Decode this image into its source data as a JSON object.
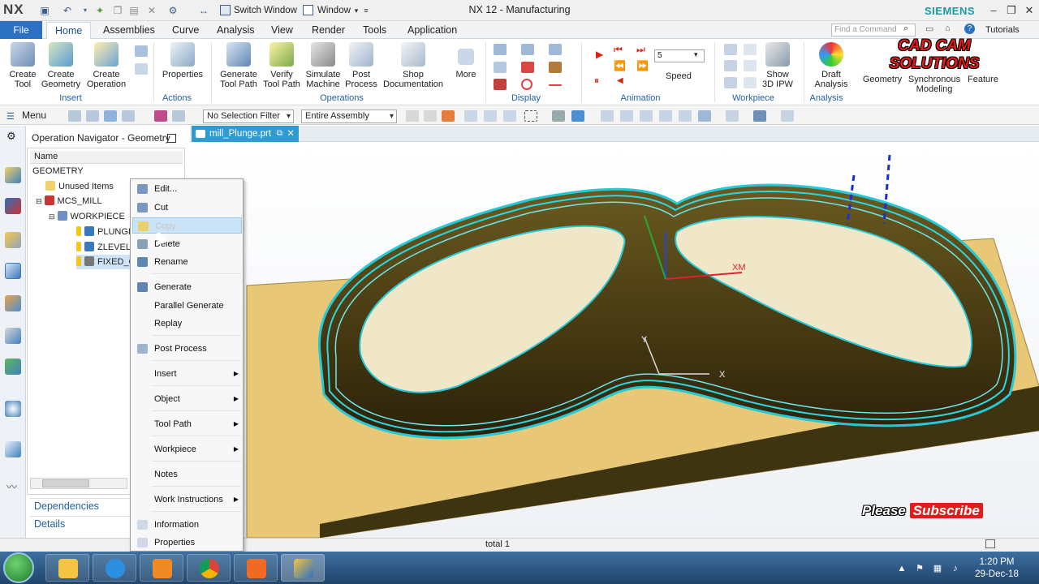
{
  "titlebar": {
    "logo": "NX",
    "switch_window": "Switch Window",
    "window_menu": "Window",
    "title": "NX 12 - Manufacturing",
    "brand": "SIEMENS"
  },
  "ribbon_tabs": {
    "file": "File",
    "tabs": [
      "Home",
      "Assemblies",
      "Curve",
      "Analysis",
      "View",
      "Render",
      "Tools",
      "Application"
    ],
    "active": "Home",
    "find_placeholder": "Find a Command",
    "tutorials": "Tutorials"
  },
  "ribbon": {
    "buttons": [
      {
        "label1": "Create",
        "label2": "Tool"
      },
      {
        "label1": "Create",
        "label2": "Geometry"
      },
      {
        "label1": "Create",
        "label2": "Operation"
      },
      {
        "label1": "Properties",
        "label2": ""
      },
      {
        "label1": "Generate",
        "label2": "Tool Path"
      },
      {
        "label1": "Verify",
        "label2": "Tool Path"
      },
      {
        "label1": "Simulate",
        "label2": "Machine"
      },
      {
        "label1": "Post",
        "label2": "Process"
      },
      {
        "label1": "Shop",
        "label2": "Documentation"
      },
      {
        "label1": "More",
        "label2": ""
      },
      {
        "label1": "Show",
        "label2": "3D IPW"
      },
      {
        "label1": "Draft",
        "label2": "Analysis"
      },
      {
        "label1": "Geometry",
        "label2": ""
      },
      {
        "label1": "Synchronous",
        "label2": "Modeling"
      },
      {
        "label1": "Feature",
        "label2": ""
      }
    ],
    "groups": [
      "Insert",
      "Actions",
      "Operations",
      "Display",
      "Animation",
      "Workpiece",
      "Analysis"
    ],
    "speed_value": "5",
    "speed_label": "Speed"
  },
  "watermark": {
    "line1": "CAD CAM",
    "line2": "SOLUTIONS"
  },
  "toolbar2": {
    "menu": "Menu",
    "selection_filter": "No Selection Filter",
    "assembly_scope": "Entire Assembly"
  },
  "navigator": {
    "title": "Operation Navigator - Geometry",
    "column": "Name",
    "rows": [
      "GEOMETRY",
      "Unused Items",
      "MCS_MILL",
      "WORKPIECE",
      "PLUNGING",
      "ZLEVEL_",
      "FIXED_C"
    ],
    "dependencies": "Dependencies",
    "details": "Details"
  },
  "viewport": {
    "file_tab": "mill_Plunge.prt",
    "axis_xm": "XM",
    "axis_x": "X",
    "axis_y": "Y"
  },
  "context_menu": {
    "items": [
      "Edit...",
      "Cut",
      "Copy",
      "Delete",
      "Rename",
      "Generate",
      "Parallel Generate",
      "Replay",
      "Post Process",
      "Insert",
      "Object",
      "Tool Path",
      "Workpiece",
      "Notes",
      "Work Instructions",
      "Information",
      "Properties"
    ],
    "highlighted": "Copy"
  },
  "overlay": {
    "please": "Please",
    "subscribe": "Subscribe"
  },
  "status": {
    "text": "total 1"
  },
  "taskbar": {
    "time": "1:20 PM",
    "date": "29-Dec-18"
  }
}
